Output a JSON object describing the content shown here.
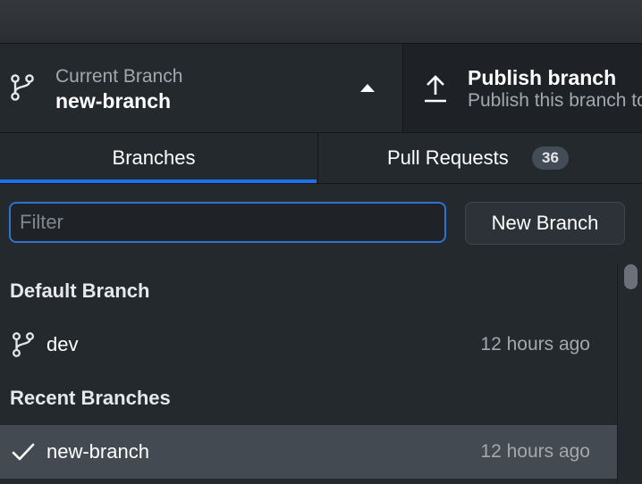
{
  "toolbar": {
    "current_branch_label": "Current Branch",
    "current_branch_name": "new-branch",
    "publish_title": "Publish branch",
    "publish_subtitle": "Publish this branch to GitHub"
  },
  "tabs": [
    {
      "label": "Branches",
      "selected": true
    },
    {
      "label": "Pull Requests",
      "badge": "36",
      "selected": false
    }
  ],
  "filter": {
    "placeholder": "Filter",
    "value": ""
  },
  "new_branch_label": "New Branch",
  "groups": {
    "default": {
      "header": "Default Branch",
      "branches": [
        {
          "name": "dev",
          "time": "12 hours ago",
          "icon": "git-branch-icon"
        }
      ]
    },
    "recent": {
      "header": "Recent Branches",
      "branches": [
        {
          "name": "new-branch",
          "time": "12 hours ago",
          "icon": "check-icon",
          "selected": true
        }
      ]
    }
  },
  "colors": {
    "accent": "#1f6feb",
    "focus_border": "#2f72d2",
    "background": "#24292e",
    "selected_row": "#444a51"
  }
}
